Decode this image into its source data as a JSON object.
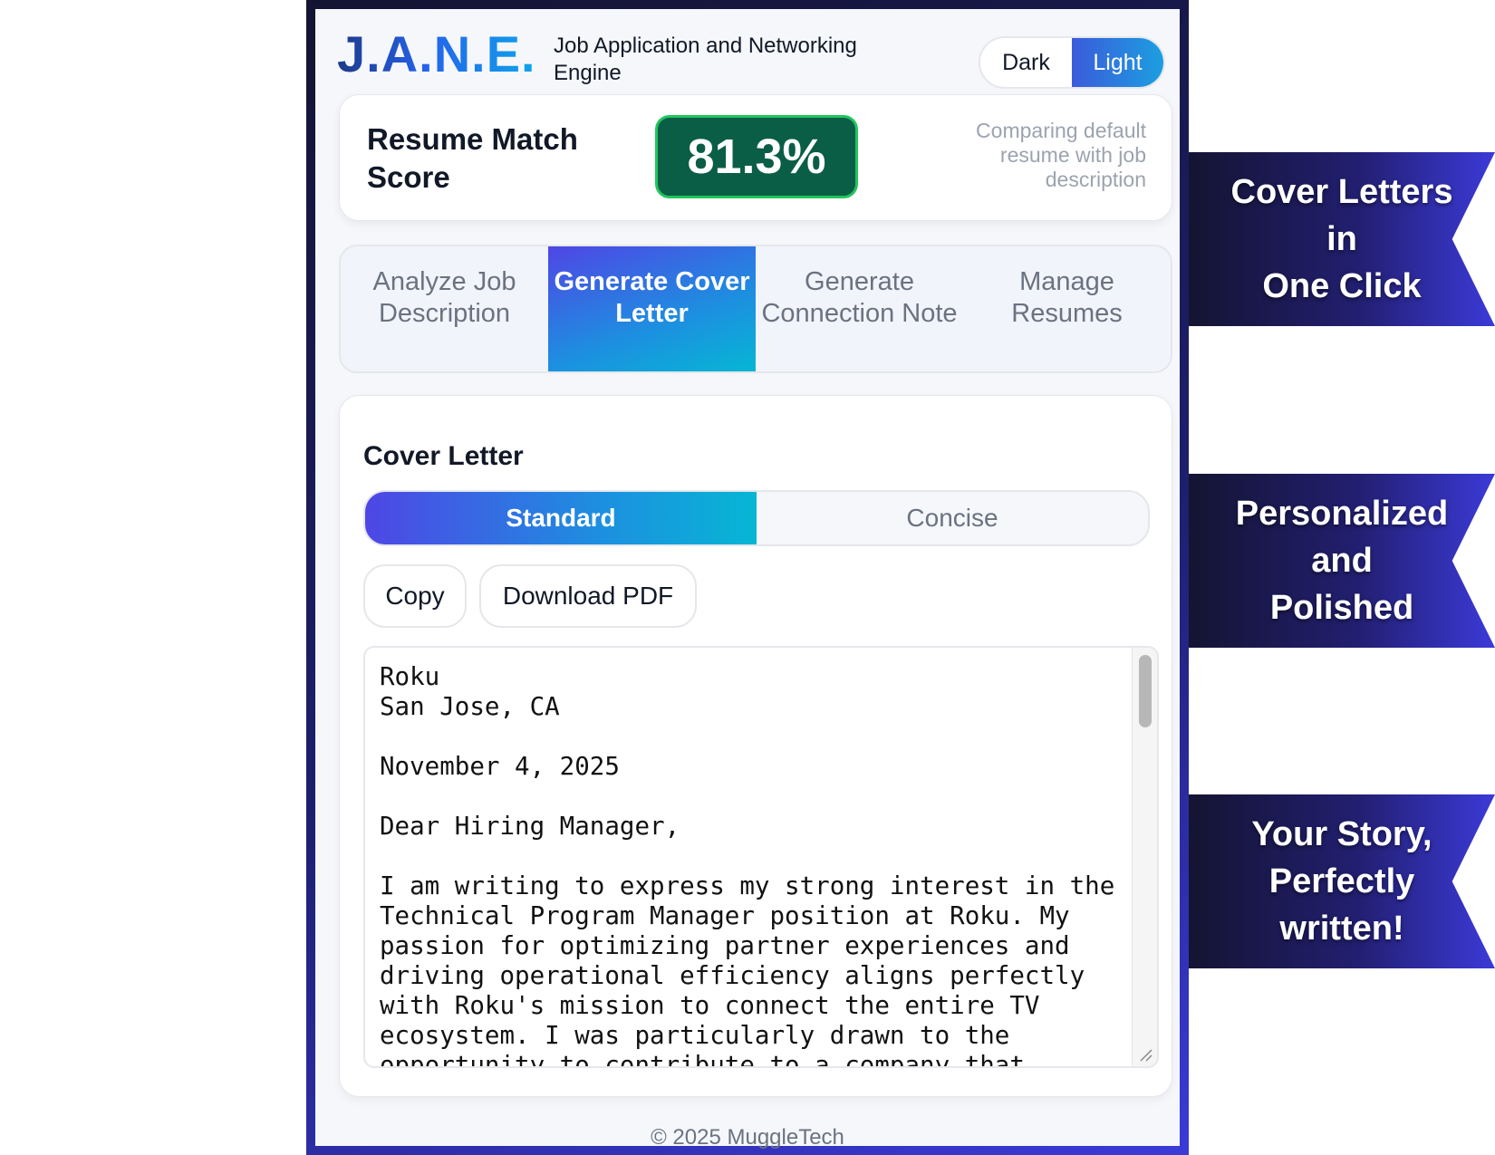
{
  "app": {
    "logo": "J.A.N.E.",
    "tagline": "Job Application and Networking Engine",
    "theme": {
      "options": [
        "Dark",
        "Light"
      ],
      "selected": "Light"
    }
  },
  "score": {
    "title": "Resume Match Score",
    "value": "81.3%",
    "note": "Comparing default resume with job description"
  },
  "tabs": [
    {
      "label": "Analyze Job Description",
      "active": false
    },
    {
      "label": "Generate Cover Letter",
      "active": true
    },
    {
      "label": "Generate Connection Note",
      "active": false
    },
    {
      "label": "Manage Resumes",
      "active": false
    }
  ],
  "cover_letter": {
    "title": "Cover Letter",
    "styles": [
      "Standard",
      "Concise"
    ],
    "selected_style": "Standard",
    "copy_label": "Copy",
    "download_label": "Download PDF",
    "text": "Roku\nSan Jose, CA\n\nNovember 4, 2025\n\nDear Hiring Manager,\n\nI am writing to express my strong interest in the Technical Program Manager position at Roku. My passion for optimizing partner experiences and driving operational efficiency aligns perfectly with Roku's mission to connect the entire TV ecosystem. I was particularly drawn to the opportunity to contribute to a company that"
  },
  "footer": "© 2025 MuggleTech",
  "banners": [
    "Cover Letters\nin\nOne Click",
    "Personalized\nand\nPolished",
    "Your Story,\nPerfectly\nwritten!"
  ],
  "colors": {
    "accent_gradient_start": "#4f46e5",
    "accent_gradient_end": "#06b6d4",
    "score_bg": "#0b5e46",
    "score_border": "#22c55e",
    "banner_dark": "#141432"
  },
  "icons": {
    "resize": "resize-handle-icon"
  }
}
